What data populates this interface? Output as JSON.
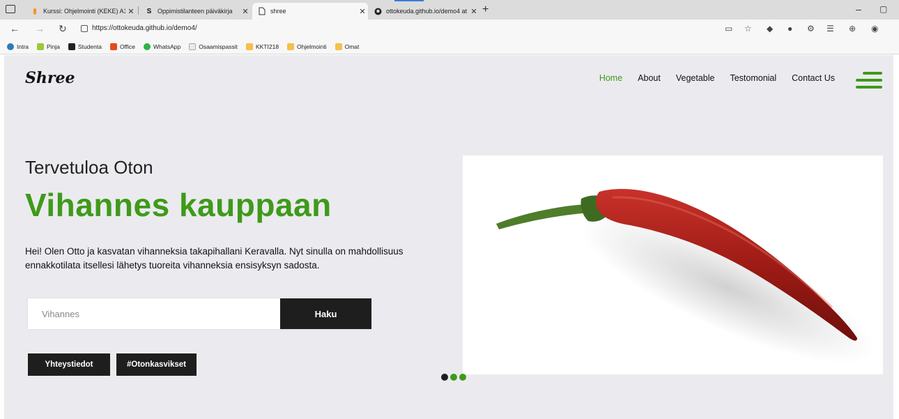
{
  "browser": {
    "tabs": [
      {
        "title": "Kurssi: Ohjelmointi (KEKE) A1",
        "icon": "moodle-icon",
        "active": false
      },
      {
        "title": "Oppimistilanteen päiväkirja",
        "icon": "studenta-icon",
        "active": false
      },
      {
        "title": "shree",
        "icon": "page-icon",
        "active": true
      },
      {
        "title": "ottokeuda.github.io/demo4 at m",
        "icon": "github-icon",
        "active": false
      }
    ],
    "url": "https://ottokeuda.github.io/demo4/",
    "bookmarks": [
      {
        "label": "Intra",
        "icon": "intra-icon"
      },
      {
        "label": "Pinja",
        "icon": "pinja-icon"
      },
      {
        "label": "Studenta",
        "icon": "studenta-icon"
      },
      {
        "label": "Office",
        "icon": "office-icon"
      },
      {
        "label": "WhatsApp",
        "icon": "whatsapp-icon"
      },
      {
        "label": "Osaamispassit",
        "icon": "osaamispassit-icon"
      },
      {
        "label": "KKTI218",
        "icon": "folder-icon"
      },
      {
        "label": "Ohjelmointi",
        "icon": "folder-icon"
      },
      {
        "label": "Omat",
        "icon": "folder-icon"
      }
    ]
  },
  "site": {
    "logo": "Shree",
    "nav": [
      "Home",
      "About",
      "Vegetable",
      "Testomonial",
      "Contact Us"
    ],
    "welcome": "Tervetuloa Oton",
    "headline": "Vihannes kauppaan",
    "intro": "Hei! Olen Otto ja kasvatan vihanneksia takapihallani Keravalla. Nyt sinulla on mahdollisuus ennakkotilata itsellesi lähetys tuoreita vihanneksia ensisyksyn sadosta.",
    "search_placeholder": "Vihannes",
    "search_button": "Haku",
    "button_contact": "Yhteystiedot",
    "button_hashtag": "#Otonkasvikset",
    "colors": {
      "accent": "#3f9a1a",
      "dark": "#1e1e1e",
      "background": "#ebebef"
    }
  }
}
